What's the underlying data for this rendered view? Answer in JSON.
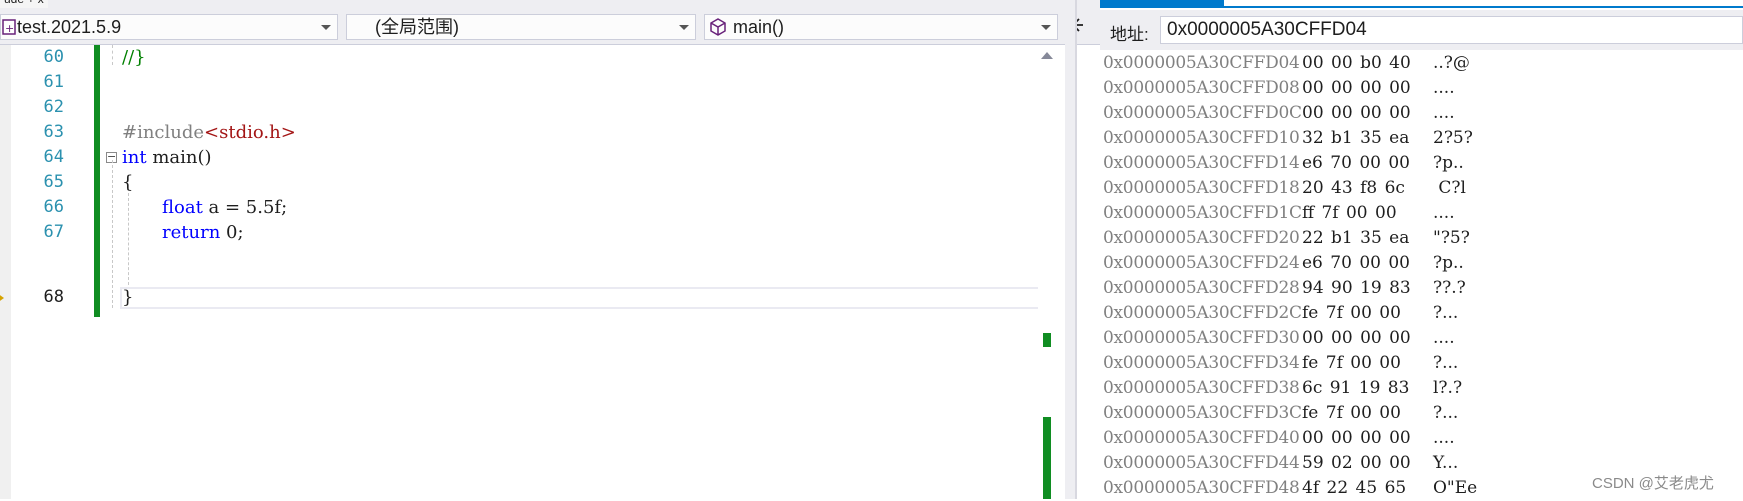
{
  "window": {
    "top_tab_label": "ude  + x"
  },
  "nav_bar": {
    "project_combo": "test.2021.5.9",
    "scope_combo": "(全局范围)",
    "member_combo": "main()",
    "project_icon": "cpp-project-icon",
    "member_icon": "cube-function-icon",
    "split_icon": "split-window-icon"
  },
  "editor": {
    "lines": [
      {
        "num": "60"
      },
      {
        "num": "61"
      },
      {
        "num": "62"
      },
      {
        "num": "63"
      },
      {
        "num": "64"
      },
      {
        "num": "65"
      },
      {
        "num": "66"
      },
      {
        "num": "67"
      },
      {
        "num": "68"
      }
    ],
    "code": {
      "l60": "//}",
      "l63_directive": "#include",
      "l63_header": "<stdio.h>",
      "l64_kw": "int",
      "l64_rest": " main()",
      "l65": "{",
      "l66_kw": "float",
      "l66_rest": " a = 5.5f;",
      "l67_kw": "return",
      "l67_rest": " 0;",
      "l68": "}"
    },
    "current_line": "68",
    "outline_toggle": "−"
  },
  "memory": {
    "address_label": "地址:",
    "address_value": "0x0000005A30CFFD04",
    "rows": [
      {
        "addr": "0x0000005A30CFFD04",
        "bytes": "00 00 b0 40",
        "ascii": "..?@"
      },
      {
        "addr": "0x0000005A30CFFD08",
        "bytes": "00 00 00 00",
        "ascii": "...."
      },
      {
        "addr": "0x0000005A30CFFD0C",
        "bytes": "00 00 00 00",
        "ascii": "...."
      },
      {
        "addr": "0x0000005A30CFFD10",
        "bytes": "32 b1 35 ea",
        "ascii": "2?5?"
      },
      {
        "addr": "0x0000005A30CFFD14",
        "bytes": "e6 70 00 00",
        "ascii": "?p.."
      },
      {
        "addr": "0x0000005A30CFFD18",
        "bytes": "20 43 f8 6c",
        "ascii": " C?l"
      },
      {
        "addr": "0x0000005A30CFFD1C",
        "bytes": "ff 7f 00 00",
        "ascii": "...."
      },
      {
        "addr": "0x0000005A30CFFD20",
        "bytes": "22 b1 35 ea",
        "ascii": "\"?5?"
      },
      {
        "addr": "0x0000005A30CFFD24",
        "bytes": "e6 70 00 00",
        "ascii": "?p.."
      },
      {
        "addr": "0x0000005A30CFFD28",
        "bytes": "94 90 19 83",
        "ascii": "??.?"
      },
      {
        "addr": "0x0000005A30CFFD2C",
        "bytes": "fe 7f 00 00",
        "ascii": "?..."
      },
      {
        "addr": "0x0000005A30CFFD30",
        "bytes": "00 00 00 00",
        "ascii": "...."
      },
      {
        "addr": "0x0000005A30CFFD34",
        "bytes": "fe 7f 00 00",
        "ascii": "?..."
      },
      {
        "addr": "0x0000005A30CFFD38",
        "bytes": "6c 91 19 83",
        "ascii": "l?.?"
      },
      {
        "addr": "0x0000005A30CFFD3C",
        "bytes": "fe 7f 00 00",
        "ascii": "?..."
      },
      {
        "addr": "0x0000005A30CFFD40",
        "bytes": "00 00 00 00",
        "ascii": "...."
      },
      {
        "addr": "0x0000005A30CFFD44",
        "bytes": "59 02 00 00",
        "ascii": "Y..."
      },
      {
        "addr": "0x0000005A30CFFD48",
        "bytes": "4f 22 45 65",
        "ascii": "O\"Ee"
      }
    ]
  },
  "watermark": "CSDN @艾老虎尤",
  "colors": {
    "accent": "#007acc",
    "change_bar": "#108d22",
    "keyword": "#0000ff",
    "comment": "#008000",
    "string": "#a31515",
    "line_number": "#2b91af"
  }
}
